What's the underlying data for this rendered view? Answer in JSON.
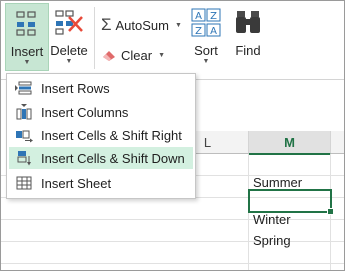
{
  "ribbon": {
    "insert_label": "Insert",
    "delete_label": "Delete",
    "autosum_label": "AutoSum",
    "clear_label": "Clear",
    "sort_label": "Sort",
    "find_label": "Find",
    "sort_icon_top": "A",
    "sort_icon_bottom": "Z",
    "sort_icon_top2": "Z",
    "sort_icon_bottom2": "A"
  },
  "menu": {
    "items": [
      {
        "label": "Insert Rows",
        "icon": "insert-rows-icon"
      },
      {
        "label": "Insert Columns",
        "icon": "insert-columns-icon"
      },
      {
        "label": "Insert Cells & Shift Right",
        "icon": "insert-cells-shift-right-icon"
      },
      {
        "label": "Insert Cells & Shift Down",
        "icon": "insert-cells-shift-down-icon",
        "highlighted": true
      },
      {
        "label": "Insert Sheet",
        "icon": "insert-sheet-icon"
      }
    ]
  },
  "grid": {
    "columns": [
      "L",
      "M"
    ],
    "cells": [
      "Summer",
      "",
      "Winter",
      "Spring"
    ]
  },
  "colors": {
    "accent": "#217346",
    "highlight": "#d3f0e0",
    "insert_button": "#c7e6d3"
  }
}
